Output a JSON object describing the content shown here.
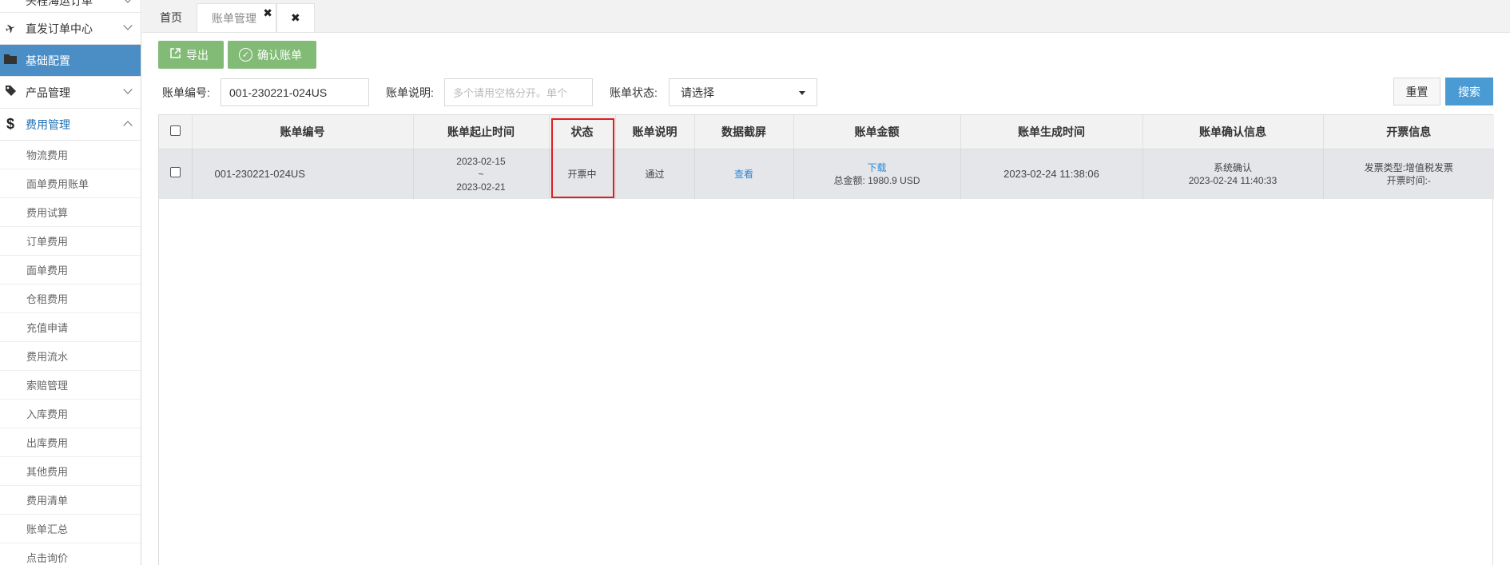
{
  "sidebar": {
    "items": [
      {
        "label": "头程海运订单",
        "icon": "",
        "partial": true
      },
      {
        "label": "直发订单中心",
        "icon": "✈"
      },
      {
        "label": "基础配置",
        "icon": "▬",
        "active": true
      },
      {
        "label": "产品管理",
        "icon": "◆"
      },
      {
        "label": "费用管理",
        "icon": "$",
        "expanded": true
      }
    ],
    "submenu": [
      "物流费用",
      "面单费用账单",
      "费用试算",
      "订单费用",
      "面单费用",
      "仓租费用",
      "充值申请",
      "费用流水",
      "索赔管理",
      "入库费用",
      "出库费用",
      "其他费用",
      "费用清单",
      "账单汇总",
      "点击询价"
    ]
  },
  "tabs": {
    "home": "首页",
    "bill": "账单管理",
    "close_glyph": "✖"
  },
  "toolbar": {
    "export_label": "导出",
    "confirm_label": "确认账单"
  },
  "filters": {
    "bill_no_label": "账单编号:",
    "bill_no_value": "001-230221-024US",
    "desc_label": "账单说明:",
    "desc_placeholder": "多个请用空格分开。单个",
    "status_label": "账单状态:",
    "status_value": "请选择",
    "reset_label": "重置",
    "search_label": "搜索"
  },
  "table": {
    "headers": [
      "账单编号",
      "账单起止时间",
      "状态",
      "账单说明",
      "数据截屏",
      "账单金额",
      "账单生成时间",
      "账单确认信息",
      "开票信息"
    ],
    "rows": [
      {
        "bill_no": "001-230221-024US",
        "start": "2023-02-15",
        "tilde": "~",
        "end": "2023-02-21",
        "status": "开票中",
        "desc": "通过",
        "screenshot": "查看",
        "download": "下载",
        "amount": "总金额: 1980.9 USD",
        "created": "2023-02-24 11:38:06",
        "confirm_by": "系统确认",
        "confirm_time": "2023-02-24 11:40:33",
        "invoice_type": "发票类型:增值税发票",
        "invoice_time": "开票时间:-"
      }
    ]
  },
  "colors": {
    "active_menu": "#4b8ec6",
    "green_button": "#82bb76",
    "search_button": "#4a9bd4",
    "highlight": "#e01e1e",
    "link": "#2a88d8"
  }
}
